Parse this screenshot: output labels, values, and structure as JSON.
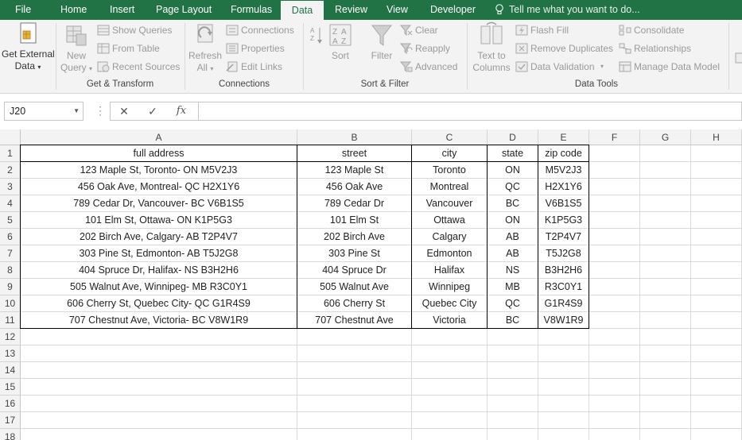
{
  "menu_tabs": [
    "File",
    "Home",
    "Insert",
    "Page Layout",
    "Formulas",
    "Data",
    "Review",
    "View",
    "Developer"
  ],
  "active_tab": "Data",
  "tell_me": "Tell me what you want to do...",
  "ribbon": {
    "get_external_data": "Get External Data",
    "get_external_data_l1": "Get External",
    "get_external_data_l2": "Data",
    "new_query_l1": "New",
    "new_query_l2": "Query",
    "show_queries": "Show Queries",
    "from_table": "From Table",
    "recent_sources": "Recent Sources",
    "get_transform_label": "Get & Transform",
    "refresh_l1": "Refresh",
    "refresh_l2": "All",
    "connections": "Connections",
    "properties": "Properties",
    "edit_links": "Edit Links",
    "connections_label": "Connections",
    "sort": "Sort",
    "filter": "Filter",
    "clear": "Clear",
    "reapply": "Reapply",
    "advanced": "Advanced",
    "sort_filter_label": "Sort & Filter",
    "text_to_columns_l1": "Text to",
    "text_to_columns_l2": "Columns",
    "flash_fill": "Flash Fill",
    "remove_duplicates": "Remove Duplicates",
    "data_validation": "Data Validation",
    "consolidate": "Consolidate",
    "relationships": "Relationships",
    "manage_data_model": "Manage Data Model",
    "data_tools_label": "Data Tools"
  },
  "formula_bar": {
    "name_box": "J20",
    "formula": ""
  },
  "columns": [
    "A",
    "B",
    "C",
    "D",
    "E",
    "F",
    "G",
    "H"
  ],
  "row_numbers": [
    "1",
    "2",
    "3",
    "4",
    "5",
    "6",
    "7",
    "8",
    "9",
    "10",
    "11",
    "12",
    "13",
    "14",
    "15",
    "16",
    "17",
    "18"
  ],
  "table": {
    "headers": [
      "full address",
      "street",
      "city",
      "state",
      "zip code"
    ],
    "rows": [
      [
        "123 Maple St, Toronto- ON M5V2J3",
        "123 Maple St",
        "Toronto",
        "ON",
        "M5V2J3"
      ],
      [
        "456 Oak Ave, Montreal- QC H2X1Y6",
        "456 Oak Ave",
        "Montreal",
        "QC",
        "H2X1Y6"
      ],
      [
        "789 Cedar Dr, Vancouver- BC V6B1S5",
        "789 Cedar Dr",
        "Vancouver",
        "BC",
        "V6B1S5"
      ],
      [
        "101 Elm St, Ottawa- ON K1P5G3",
        "101 Elm St",
        "Ottawa",
        "ON",
        "K1P5G3"
      ],
      [
        "202 Birch Ave, Calgary- AB T2P4V7",
        "202 Birch Ave",
        "Calgary",
        "AB",
        "T2P4V7"
      ],
      [
        "303 Pine St, Edmonton- AB T5J2G8",
        "303 Pine St",
        "Edmonton",
        "AB",
        "T5J2G8"
      ],
      [
        "404 Spruce Dr, Halifax- NS B3H2H6",
        "404 Spruce Dr",
        "Halifax",
        "NS",
        "B3H2H6"
      ],
      [
        "505 Walnut Ave, Winnipeg- MB R3C0Y1",
        "505 Walnut Ave",
        "Winnipeg",
        "MB",
        "R3C0Y1"
      ],
      [
        "606 Cherry St, Quebec City- QC G1R4S9",
        "606 Cherry St",
        "Quebec City",
        "QC",
        "G1R4S9"
      ],
      [
        "707 Chestnut Ave, Victoria- BC V8W1R9",
        "707 Chestnut Ave",
        "Victoria",
        "BC",
        "V8W1R9"
      ]
    ]
  },
  "colors": {
    "excel_green": "#217346",
    "ribbon_bg": "#f3f3f3",
    "header_bg": "#f3f3f3",
    "grid_line": "#dadada"
  }
}
